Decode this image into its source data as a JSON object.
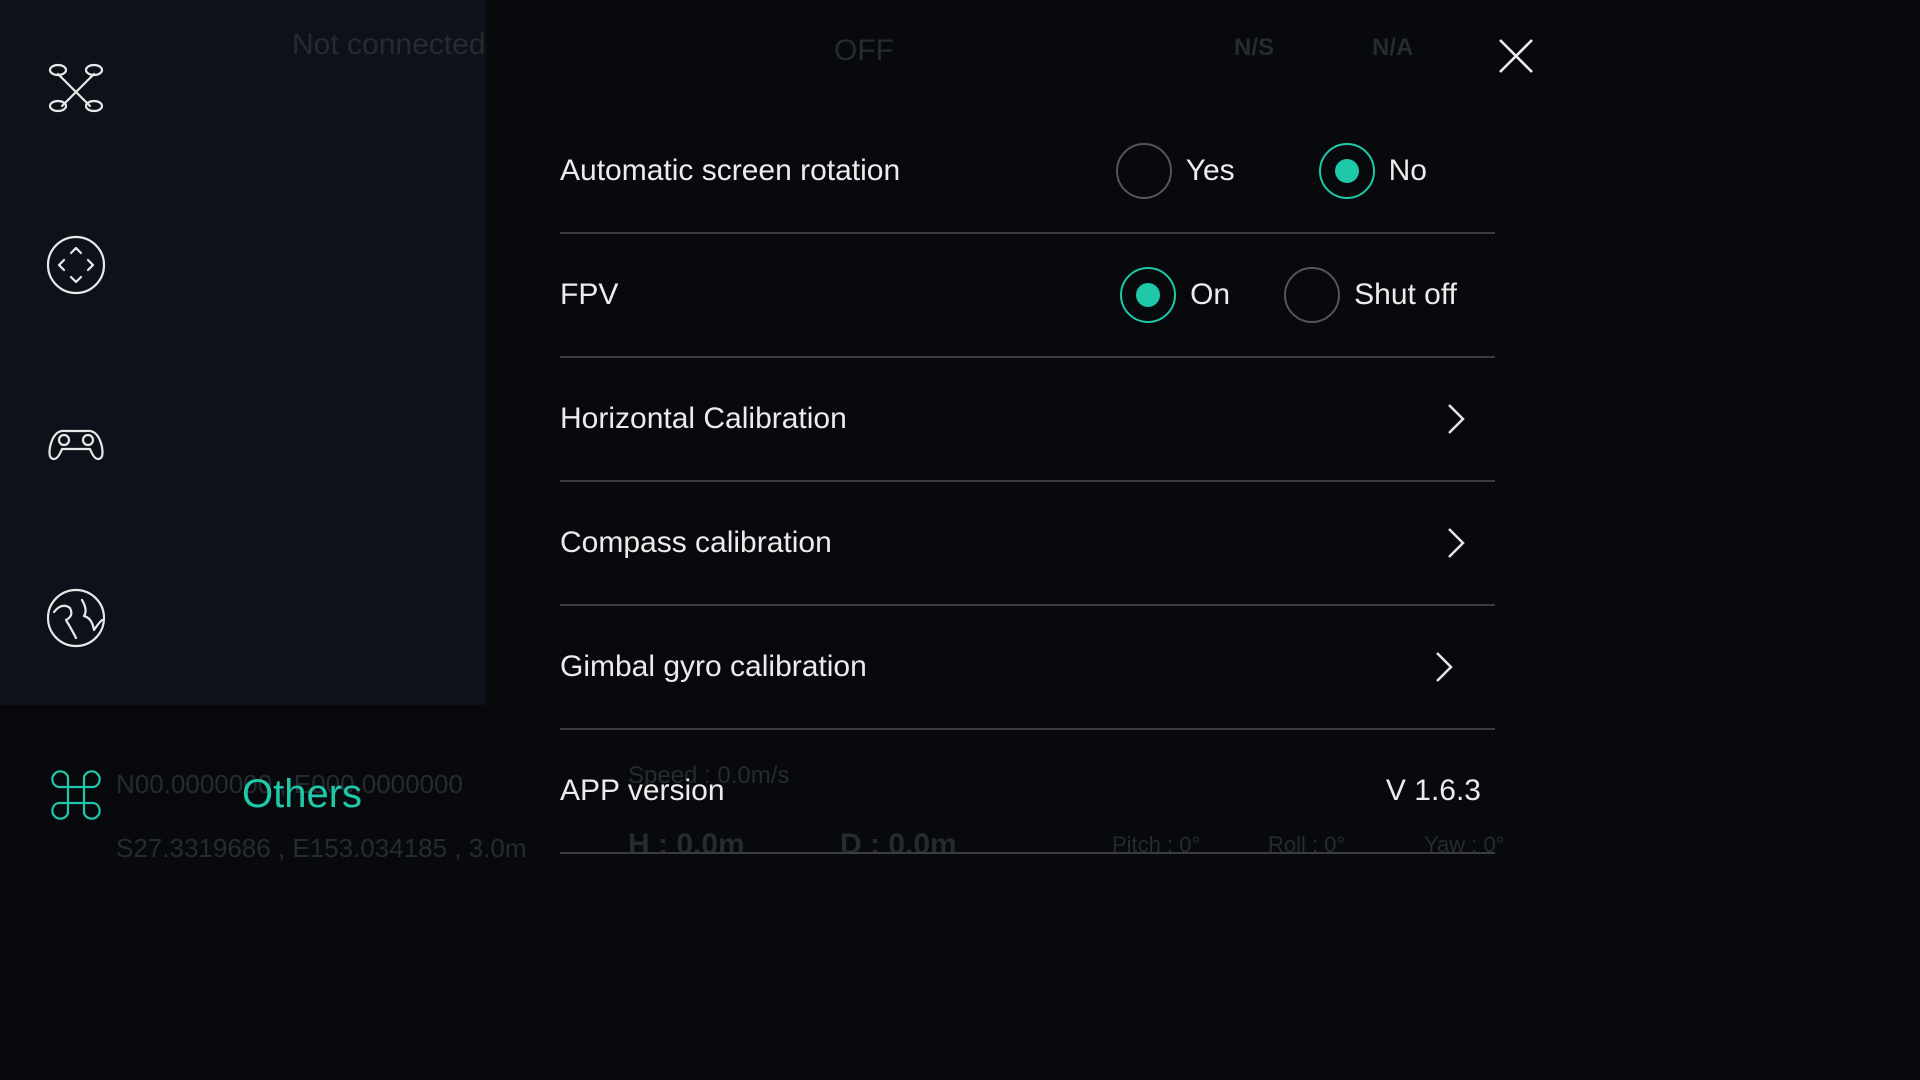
{
  "background": {
    "status": "Not connected",
    "propeller": "OFF",
    "gps": "N/S",
    "battery": "N/A",
    "coords1": "N00.0000000 , E000.0000000",
    "coords2": "S27.3319686 , E153.034185 , 3.0m",
    "speed": "Speed : 0.0m/s",
    "height": "H : 0.0m",
    "distance": "D : 0.0m",
    "pitch": "Pitch : 0°",
    "roll": "Roll : 0°",
    "yaw": "Yaw : 0°"
  },
  "sidebar": {
    "items": [
      {
        "icon": "drone-icon"
      },
      {
        "icon": "direction-pad-icon"
      },
      {
        "icon": "gamepad-icon"
      },
      {
        "icon": "globe-icon"
      },
      {
        "icon": "command-icon",
        "label": "Others",
        "active": true
      }
    ]
  },
  "accent": "#1ec8a8",
  "settings": {
    "auto_rotation": {
      "label": "Automatic screen rotation",
      "options": [
        "Yes",
        "No"
      ],
      "selected": "No"
    },
    "fpv": {
      "label": "FPV",
      "options": [
        "On",
        "Shut off"
      ],
      "selected": "On"
    },
    "horizontal_calibration": {
      "label": "Horizontal Calibration"
    },
    "compass_calibration": {
      "label": "Compass calibration"
    },
    "gimbal_calibration": {
      "label": "Gimbal gyro calibration"
    },
    "app_version": {
      "label": "APP version",
      "value": "V 1.6.3"
    }
  }
}
